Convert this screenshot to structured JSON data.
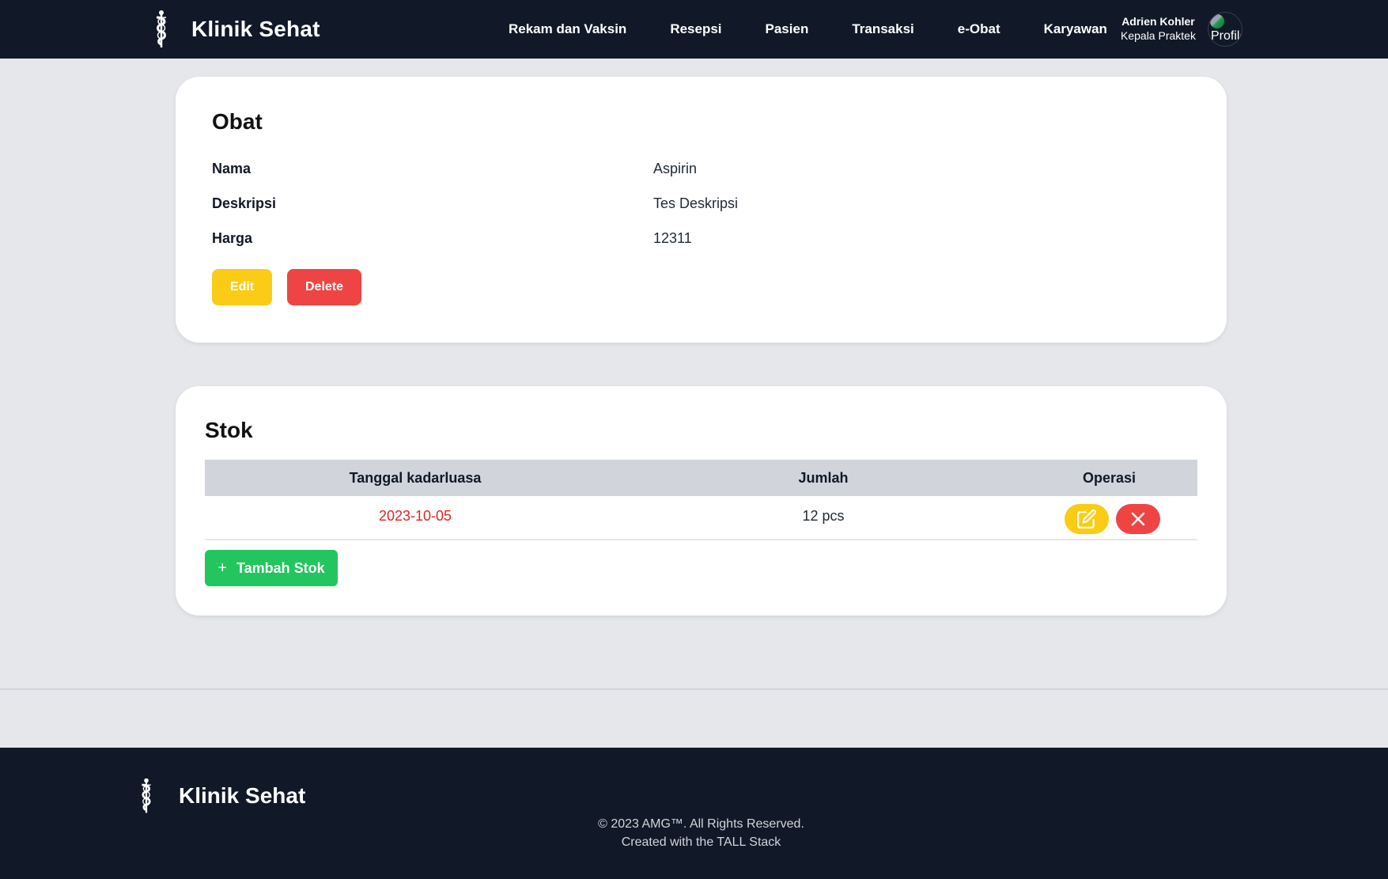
{
  "brand": {
    "name": "Klinik Sehat"
  },
  "nav": {
    "items": [
      {
        "label": "Rekam dan Vaksin"
      },
      {
        "label": "Resepsi"
      },
      {
        "label": "Pasien"
      },
      {
        "label": "Transaksi"
      },
      {
        "label": "e-Obat"
      },
      {
        "label": "Karyawan"
      }
    ]
  },
  "user": {
    "name": "Adrien Kohler",
    "role": "Kepala Praktek",
    "avatar_alt": "Profile"
  },
  "obat": {
    "title": "Obat",
    "fields": [
      {
        "label": "Nama",
        "value": "Aspirin"
      },
      {
        "label": "Deskripsi",
        "value": "Tes Deskripsi"
      },
      {
        "label": "Harga",
        "value": "12311"
      }
    ],
    "edit_label": "Edit",
    "delete_label": "Delete"
  },
  "stok": {
    "title": "Stok",
    "columns": [
      "Tanggal kadarluasa",
      "Jumlah",
      "Operasi"
    ],
    "rows": [
      {
        "tanggal": "2023-10-05",
        "jumlah": "12 pcs"
      }
    ],
    "add_label": "Tambah Stok"
  },
  "footer": {
    "brand": "Klinik Sehat",
    "copyright": "© 2023 AMG™. All Rights Reserved.",
    "created": "Created with the TALL Stack"
  },
  "colors": {
    "nav_bg": "#111827",
    "edit": "#facc15",
    "delete": "#ef4444",
    "add": "#22c55e",
    "date_text": "#dc2626"
  },
  "icons": {
    "logo": "caduceus-icon",
    "row_edit": "edit-icon",
    "row_delete": "close-icon",
    "add": "plus-icon"
  }
}
